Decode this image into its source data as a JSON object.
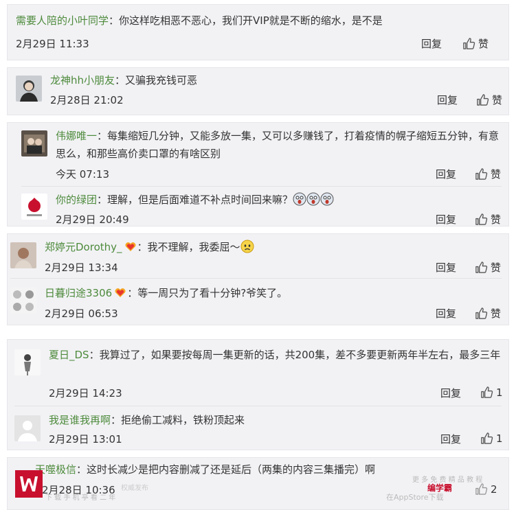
{
  "colors": {
    "username": "#4d8a3b",
    "card_bg": "#f2f2f5",
    "logo_red": "#c8102e"
  },
  "actions": {
    "reply": "回复",
    "like": "赞"
  },
  "cards": [
    {
      "comments": [
        {
          "user": "需要人陪的小叶同学",
          "sep": "：",
          "text": "你这样吃相恶不恶心，我们开VIP就是不断的缩水，是不是",
          "time": "2月29日 11:33"
        }
      ]
    },
    {
      "comments": [
        {
          "user": "龙神hh小朋友",
          "sep": "：",
          "text": "又骗我充钱可恶",
          "time": "2月28日 21:02",
          "avatar": "user-photo"
        }
      ]
    },
    {
      "comments": [
        {
          "user": "伟娜唯一",
          "sep": "：",
          "text": "每集缩短几分钟，又能多放一集，又可以多赚钱了，打着疫情的幌子缩短五分钟，有意思么，和那些高价卖口罩的有啥区别",
          "time": "今天 07:13",
          "avatar": "user-photo"
        },
        {
          "user": "你的绿团",
          "sep": "：",
          "text": "理解，但是后面难道不补点时间回来嘛？",
          "time": "2月29日 20:49",
          "avatar": "user-photo",
          "emojis": [
            "scared-face-emoji",
            "scared-face-emoji",
            "scared-face-emoji"
          ]
        }
      ]
    },
    {
      "comments": [
        {
          "user": "郑婷元Dorothy_",
          "sep": "：",
          "text": "我不理解，我委屈～",
          "time": "2月29日 13:34",
          "avatar": "user-photo",
          "badge": "vip-heart-badge",
          "emojis": [
            "sad-face-emoji"
          ]
        },
        {
          "user": "日暮归途3306",
          "sep": "：",
          "text": "等一周只为了看十分钟?爷笑了。",
          "time": "2月29日 06:53",
          "avatar": "user-photo",
          "badge": "vip-heart-badge"
        }
      ]
    },
    {
      "comments": [
        {
          "user": "夏日_DS",
          "sep": "：",
          "text": "我算过了，如果要按每周一集更新的话，共200集，差不多要更新两年半左右，最多三年",
          "time": "2月29日 14:23",
          "avatar": "user-photo",
          "likes": "1"
        },
        {
          "user": "我是谁我再啊",
          "sep": "：",
          "text": "拒绝偷工减料，铁粉顶起来",
          "time": "2月29日 13:01",
          "avatar": "default-avatar",
          "likes": "1"
        }
      ]
    },
    {
      "comments": [
        {
          "user": "天噬极信",
          "sep": "：",
          "text": "这时长减少是把内容删减了还是延后（两集的内容三集播完）啊",
          "time": "2月28日 10:36",
          "likes": "2"
        }
      ]
    }
  ],
  "watermark": {
    "left_small": "下 载 手 机 亭 看 二 年",
    "right_top": "更 多 免 费 精 品 教 程",
    "right_bottom": "在AppStore下载",
    "brand": "编学霸",
    "brand_small": "权威发布"
  }
}
